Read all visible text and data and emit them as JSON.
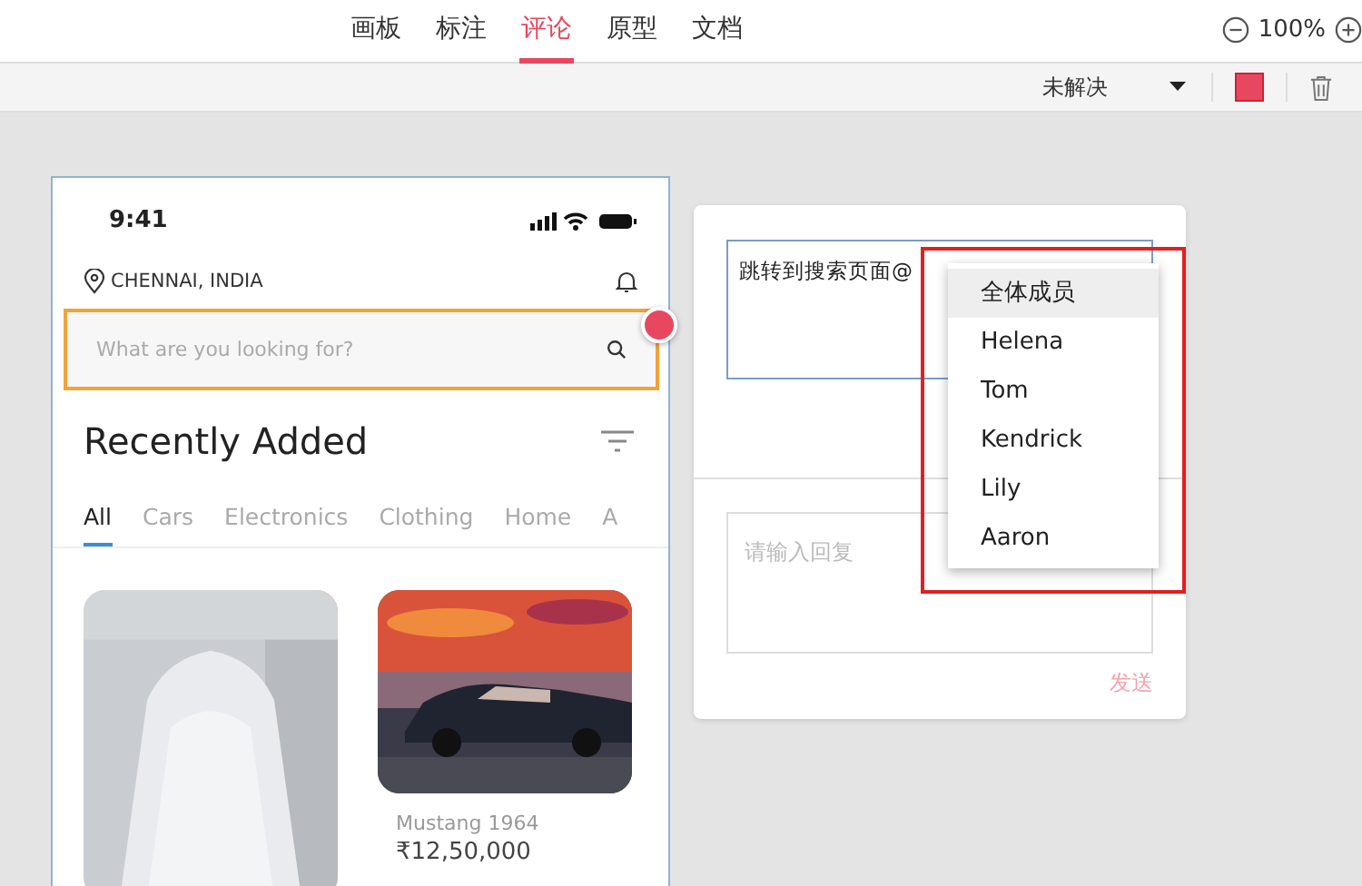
{
  "top_tabs": [
    {
      "label": "画板",
      "selected": false
    },
    {
      "label": "标注",
      "selected": false
    },
    {
      "label": "评论",
      "selected": true
    },
    {
      "label": "原型",
      "selected": false
    },
    {
      "label": "文档",
      "selected": false
    }
  ],
  "zoom": {
    "label": "100%"
  },
  "toolbar": {
    "status_filter": "未解决"
  },
  "phone": {
    "time": "9:41",
    "location": "CHENNAI, INDIA",
    "search_placeholder": "What are you looking for?",
    "section_title": "Recently Added",
    "categories": [
      {
        "label": "All",
        "selected": true
      },
      {
        "label": "Cars",
        "selected": false
      },
      {
        "label": "Electronics",
        "selected": false
      },
      {
        "label": "Clothing",
        "selected": false
      },
      {
        "label": "Home",
        "selected": false
      },
      {
        "label": "A",
        "selected": false
      }
    ],
    "product": {
      "name": "Mustang 1964",
      "price": "₹12,50,000"
    }
  },
  "comment": {
    "text": "跳转到搜索页面@",
    "mention_menu": [
      {
        "label": "全体成员",
        "selected": true
      },
      {
        "label": "Helena",
        "selected": false
      },
      {
        "label": "Tom",
        "selected": false
      },
      {
        "label": "Kendrick",
        "selected": false
      },
      {
        "label": "Lily",
        "selected": false
      },
      {
        "label": "Aaron",
        "selected": false
      }
    ],
    "reply_placeholder": "请输入回复",
    "send_button": "发送"
  }
}
